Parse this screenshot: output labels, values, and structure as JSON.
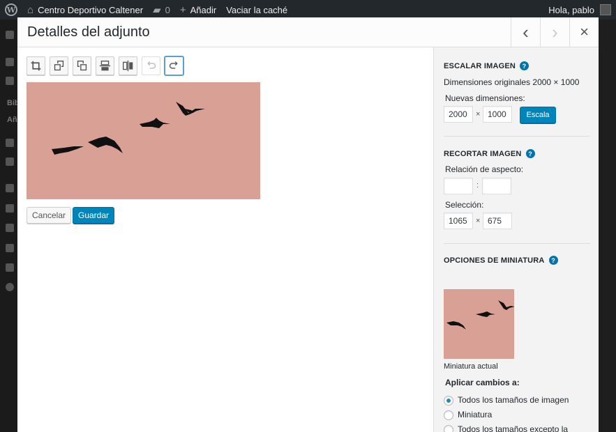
{
  "adminbar": {
    "site_name": "Centro Deportivo Caltener",
    "comments_count": "0",
    "add_new": "Añadir",
    "clear_cache": "Vaciar la caché",
    "greeting": "Hola, pablo"
  },
  "sidebar": {
    "partial_labels": [
      "Bib",
      "Añ"
    ]
  },
  "modal": {
    "title": "Detalles del adjunto",
    "prev_label": "‹",
    "next_label": "›",
    "close_label": "×"
  },
  "editor": {
    "tools": [
      {
        "name": "crop-icon"
      },
      {
        "name": "rotate-left-icon"
      },
      {
        "name": "rotate-right-icon"
      },
      {
        "name": "flip-vertical-icon"
      },
      {
        "name": "flip-horizontal-icon"
      },
      {
        "name": "undo-icon"
      },
      {
        "name": "redo-icon"
      }
    ],
    "cancel_label": "Cancelar",
    "save_label": "Guardar",
    "image_background": "#d9a196"
  },
  "panel": {
    "scale": {
      "title": "ESCALAR IMAGEN",
      "original_dims": "Dimensiones originales 2000 × 1000",
      "new_dims_label": "Nuevas dimensiones:",
      "width": "2000",
      "height": "1000",
      "separator": "×",
      "button": "Escala"
    },
    "crop": {
      "title": "RECORTAR IMAGEN",
      "aspect_label": "Relación de aspecto:",
      "aspect_w": "",
      "aspect_h": "",
      "aspect_separator": ":",
      "selection_label": "Selección:",
      "sel_w": "1065",
      "sel_h": "675",
      "separator": "×"
    },
    "thumbnail": {
      "title": "OPCIONES DE MINIATURA",
      "current_label": "Miniatura actual",
      "apply_label": "Aplicar cambios a:",
      "options": [
        {
          "label": "Todos los tamaños de imagen",
          "checked": true
        },
        {
          "label": "Miniatura",
          "checked": false
        },
        {
          "label": "Todos los tamaños excepto la miniatura",
          "checked": false
        }
      ]
    }
  },
  "colors": {
    "accent": "#0085ba",
    "admin_bar": "#23282d",
    "image_pink": "#d9a196"
  }
}
